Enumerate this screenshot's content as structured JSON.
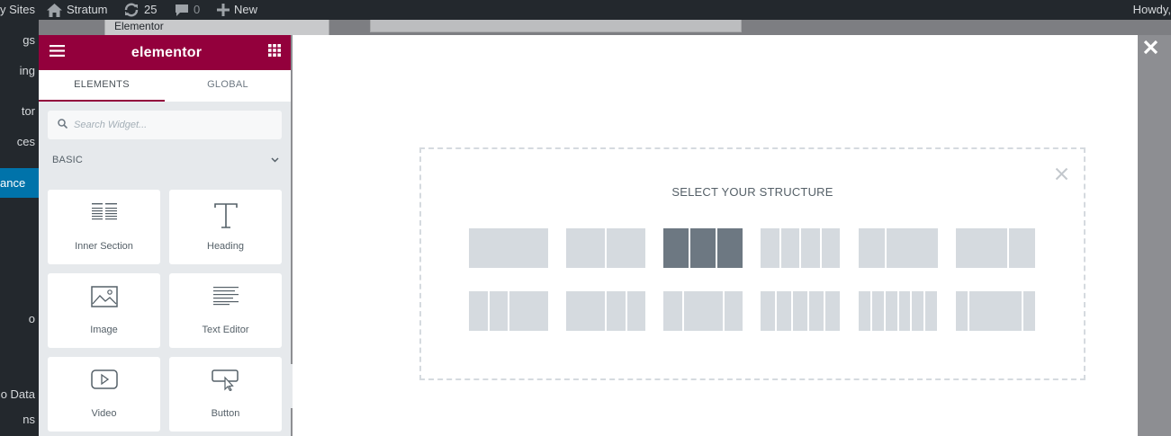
{
  "admin_bar": {
    "my_sites": "y Sites",
    "site_name": "Stratum",
    "updates_count": "25",
    "comments_count": "0",
    "new_label": "New",
    "howdy": "Howdy,"
  },
  "admin_menu": {
    "items": [
      "gs",
      "ing",
      "tor",
      "ces",
      "ance",
      "o",
      "o Data",
      "ns"
    ]
  },
  "background": {
    "breadcrumb": "Elementor"
  },
  "panel": {
    "logo": "elementor",
    "tabs": [
      {
        "label": "ELEMENTS"
      },
      {
        "label": "GLOBAL"
      }
    ],
    "search_placeholder": "Search Widget...",
    "category": "BASIC",
    "widgets": [
      {
        "label": "Inner Section",
        "icon": "inner-section-icon"
      },
      {
        "label": "Heading",
        "icon": "heading-icon"
      },
      {
        "label": "Image",
        "icon": "image-icon"
      },
      {
        "label": "Text Editor",
        "icon": "text-editor-icon"
      },
      {
        "label": "Video",
        "icon": "video-icon"
      },
      {
        "label": "Button",
        "icon": "button-icon"
      }
    ]
  },
  "structure": {
    "title": "SELECT YOUR STRUCTURE",
    "selected_preset": 3
  },
  "colors": {
    "brand": "#93003c",
    "admin_bar": "#23282d",
    "admin_active": "#0073aa",
    "preset": "#d5dadf",
    "preset_selected": "#6d7882"
  }
}
